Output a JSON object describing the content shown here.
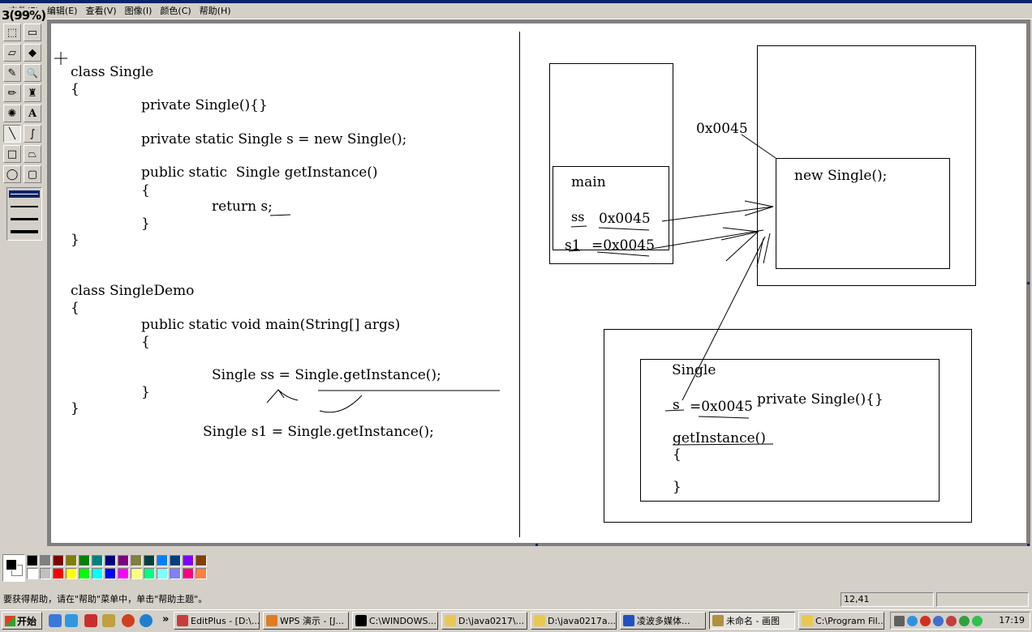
{
  "zoom_tag": "3(99%)",
  "menu": [
    "文件(F)",
    "编辑(E)",
    "查看(V)",
    "图像(I)",
    "颜色(C)",
    "帮助(H)"
  ],
  "tools": [
    {
      "name": "free-select",
      "glyph": "⬚"
    },
    {
      "name": "rect-select",
      "glyph": "▭"
    },
    {
      "name": "eraser",
      "glyph": "▱"
    },
    {
      "name": "fill",
      "glyph": "◆"
    },
    {
      "name": "color-picker",
      "glyph": "✎"
    },
    {
      "name": "magnifier",
      "glyph": "🔍"
    },
    {
      "name": "pencil",
      "glyph": "✏"
    },
    {
      "name": "brush",
      "glyph": "♜"
    },
    {
      "name": "airbrush",
      "glyph": "✺"
    },
    {
      "name": "text",
      "glyph": "A"
    },
    {
      "name": "line",
      "glyph": "╲"
    },
    {
      "name": "curve",
      "glyph": "∫"
    },
    {
      "name": "rectangle",
      "glyph": "□"
    },
    {
      "name": "polygon",
      "glyph": "⏢"
    },
    {
      "name": "ellipse",
      "glyph": "◯"
    },
    {
      "name": "rounded-rect",
      "glyph": "▢"
    }
  ],
  "canvas": {
    "code_left": [
      "class Single",
      "{",
      "private Single(){}",
      "private static Single s = new Single();",
      "public static  Single getInstance()",
      "{",
      "return s;",
      "}",
      "}",
      "class SingleDemo",
      "{",
      "public static void main(String[] args)",
      "{",
      "Single ss = Single.getInstance();",
      "}",
      "}",
      "Single s1 = Single.getInstance();"
    ],
    "stack_frame": {
      "title": "main",
      "var1_name": "ss",
      "var1_value": "0x0045",
      "var2_name": "s1",
      "var2_value": "=0x0045"
    },
    "heap_address": "0x0045",
    "heap_object": "new Single();",
    "method_area": {
      "class_name": "Single",
      "field_name": "s",
      "field_value": "=0x0045",
      "constructor": "private Single(){}",
      "method": "getInstance()",
      "open_brace": "{",
      "close_brace": "}"
    }
  },
  "palette": [
    "#000000",
    "#808080",
    "#800000",
    "#808000",
    "#008000",
    "#008080",
    "#000080",
    "#800080",
    "#808040",
    "#004040",
    "#0080ff",
    "#004080",
    "#8000ff",
    "#804000",
    "#ffffff",
    "#c0c0c0",
    "#ff0000",
    "#ffff00",
    "#00ff00",
    "#00ffff",
    "#0000ff",
    "#ff00ff",
    "#ffff80",
    "#00ff80",
    "#80ffff",
    "#8080ff",
    "#ff0080",
    "#ff8040"
  ],
  "status": {
    "help_text": "要获得帮助，请在\"帮助\"菜单中，单击\"帮助主题\"。",
    "coords": "12,41",
    "size": ""
  },
  "taskbar": {
    "start_label": "开始",
    "chevron": "»",
    "tasks": [
      {
        "label": "EditPlus - [D:\\...",
        "icon_color": "#c83c3c",
        "active": false
      },
      {
        "label": "WPS 演示 - [J...",
        "icon_color": "#e07b20",
        "active": false
      },
      {
        "label": "C:\\WINDOWS...",
        "icon_color": "#000000",
        "active": false
      },
      {
        "label": "D:\\java0217\\...",
        "icon_color": "#e8c850",
        "active": false
      },
      {
        "label": "D:\\java0217a...",
        "icon_color": "#e8c850",
        "active": false
      },
      {
        "label": "凌波多媒体...",
        "icon_color": "#2050c0",
        "active": false
      },
      {
        "label": "未命名 - 画图",
        "icon_color": "#b09040",
        "active": true
      },
      {
        "label": "C:\\Program Fil...",
        "icon_color": "#e8c850",
        "active": false
      }
    ],
    "clock": "17:19"
  }
}
